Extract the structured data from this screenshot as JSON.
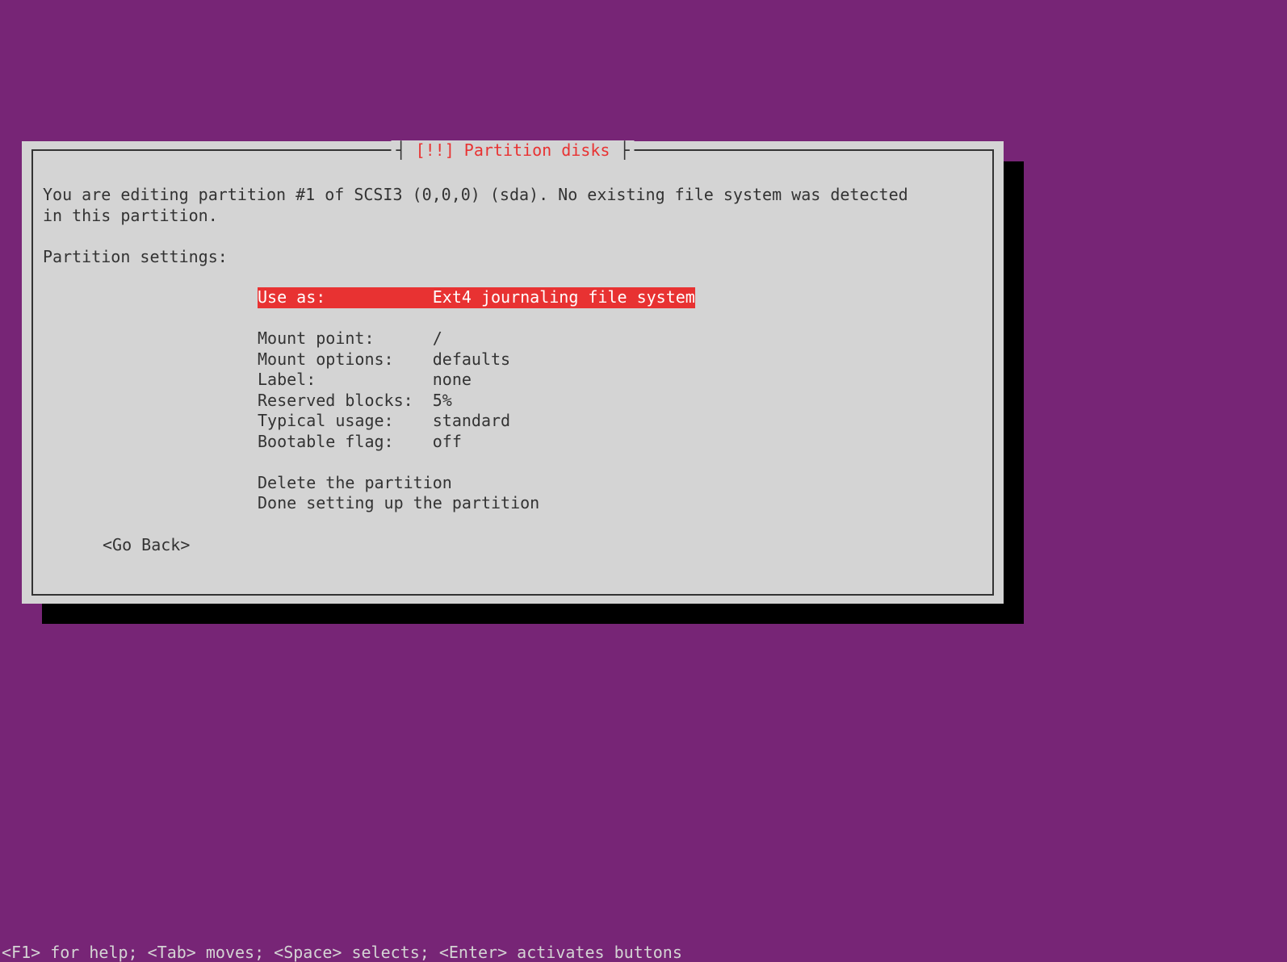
{
  "dialog": {
    "title": "[!!] Partition disks",
    "intro": "You are editing partition #1 of SCSI3 (0,0,0) (sda). No existing file system was detected\nin this partition.",
    "heading": "Partition settings:",
    "settings": [
      {
        "label": "Use as:",
        "value": "Ext4 journaling file system",
        "selected": true
      },
      {
        "label": "",
        "value": "",
        "blank": true
      },
      {
        "label": "Mount point:",
        "value": "/"
      },
      {
        "label": "Mount options:",
        "value": "defaults"
      },
      {
        "label": "Label:",
        "value": "none"
      },
      {
        "label": "Reserved blocks:",
        "value": "5%"
      },
      {
        "label": "Typical usage:",
        "value": "standard"
      },
      {
        "label": "Bootable flag:",
        "value": "off"
      },
      {
        "label": "",
        "value": "",
        "blank": true
      },
      {
        "label": "Delete the partition",
        "value": ""
      },
      {
        "label": "Done setting up the partition",
        "value": ""
      }
    ],
    "go_back": "<Go Back>"
  },
  "footer": "<F1> for help; <Tab> moves; <Space> selects; <Enter> activates buttons"
}
